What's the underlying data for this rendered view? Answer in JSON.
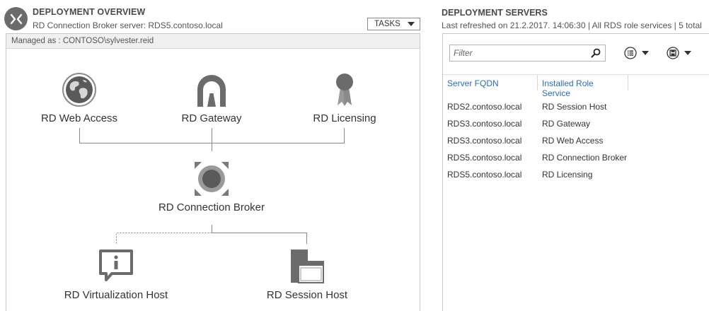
{
  "overview": {
    "title": "DEPLOYMENT OVERVIEW",
    "subtitle": "RD Connection Broker server: RDS5.contoso.local",
    "tasks_label": "TASKS",
    "managed_as": "Managed as : CONTOSO\\sylvester.reid",
    "nodes": {
      "web_access": "RD Web Access",
      "gateway": "RD Gateway",
      "licensing": "RD Licensing",
      "broker": "RD Connection Broker",
      "virtualization": "RD Virtualization Host",
      "session": "RD Session Host"
    }
  },
  "servers": {
    "title": "DEPLOYMENT SERVERS",
    "subtitle": "Last refreshed on 21.2.2017. 14:06:30 | All RDS role services  | 5 total",
    "filter_placeholder": "Filter",
    "columns": [
      "Server FQDN",
      "Installed Role Service"
    ],
    "rows": [
      [
        "RDS2.contoso.local",
        "RD Session Host"
      ],
      [
        "RDS3.contoso.local",
        "RD Gateway"
      ],
      [
        "RDS3.contoso.local",
        "RD Web Access"
      ],
      [
        "RDS5.contoso.local",
        "RD Connection Broker"
      ],
      [
        "RDS5.contoso.local",
        "RD Licensing"
      ]
    ]
  },
  "colors": {
    "icon_gray": "#6b6b6b",
    "header_blue": "#2a6fb0",
    "border": "#c8c8c8"
  }
}
